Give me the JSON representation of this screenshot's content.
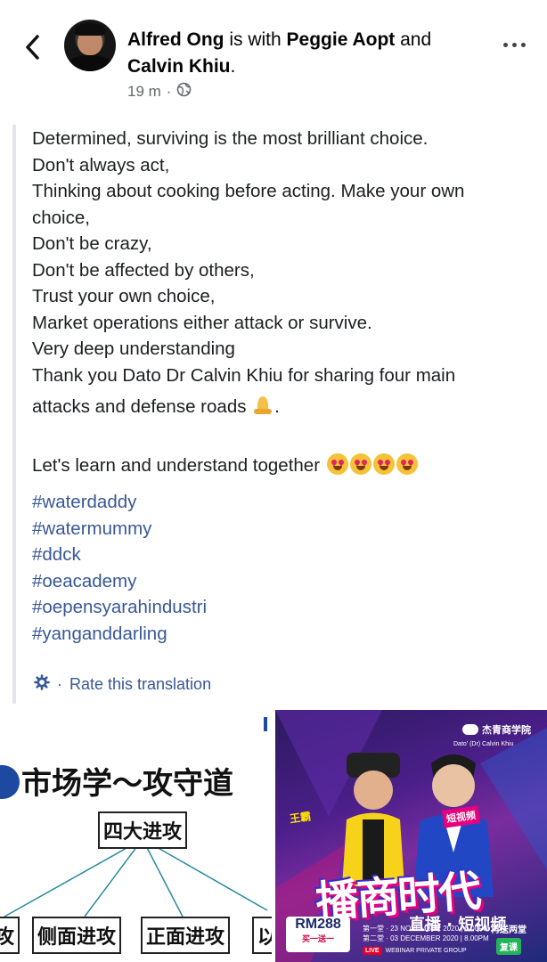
{
  "header": {
    "author": "Alfred Ong",
    "is_with": "is with",
    "tag1": "Peggie Aopt",
    "and": "and",
    "tag2": "Calvin Khiu",
    "time": "19 m",
    "separator": "·"
  },
  "post": {
    "lines": [
      "Determined, surviving is the most brilliant choice.",
      "Don't always act,",
      "Thinking about cooking before acting. Make your own",
      "choice,",
      "Don't be crazy,",
      "Don't be affected by others,",
      "Trust your own choice,",
      "Market operations either attack or survive.",
      "Very deep understanding",
      "Thank you Dato Dr Calvin Khiu for sharing four main",
      "attacks and defense roads"
    ],
    "learn_line": "Let's learn and understand together",
    "hashtags": [
      "#waterdaddy",
      "#watermummy",
      "#ddck",
      "#oeacademy",
      "#oepensyarahindustri",
      "#yanganddarling"
    ],
    "rate_translation": "Rate this translation"
  },
  "image_left": {
    "title": "市场学～攻守道",
    "box_top": "四大进攻",
    "box_1": "攻",
    "box_2": "侧面进攻",
    "box_3": "正面进攻",
    "box_4": "以"
  },
  "image_right": {
    "brand": "杰青商学院",
    "speaker_name": "Dato' (Dr) Calvin Khiu",
    "guest_label": "王霸",
    "tag_short_video": "短视频",
    "tag_live": "直播",
    "big_title": "播商时代",
    "subtitle": "直播 · 短视频",
    "price": "RM288",
    "price_note": "买一送一",
    "date1": "第一堂 · 23 NOVEMBER 2020 | 8.00PM",
    "date2": "第二堂 · 03 DECEMBER 2020 | 8.00PM",
    "live_badge": "LIVE",
    "webinar": "WEBINAR PRIVATE GROUP",
    "badge_top": "再送两堂",
    "badge_bottom": "复课"
  },
  "colors": {
    "link": "#385898",
    "text": "#1c1e21",
    "muted": "#65676b"
  }
}
